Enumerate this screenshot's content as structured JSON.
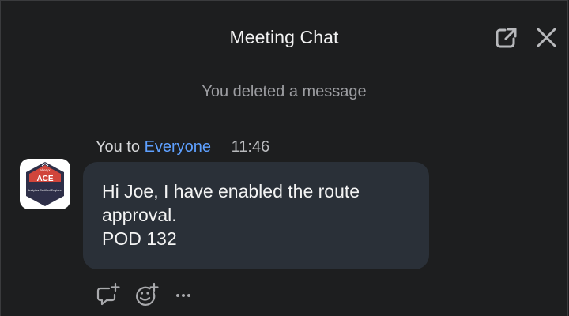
{
  "header": {
    "title": "Meeting Chat"
  },
  "icons": {
    "popout": "popout-icon",
    "close": "close-icon",
    "reply": "reply-thread-icon",
    "emoji": "add-reaction-icon",
    "more": "more-options-icon"
  },
  "system_message": "You deleted a message",
  "message": {
    "sender": "You to",
    "recipient": "Everyone",
    "time": "11:46",
    "avatar_badge": {
      "brand": "alteryx",
      "code": "ACE",
      "caption": "Analytics Certified Engineer"
    },
    "lines": [
      "Hi Joe, I have enabled the route",
      "approval.",
      "POD 132"
    ]
  },
  "colors": {
    "background": "#1d1e1f",
    "bubble": "#2a3038",
    "link": "#5ea0ff",
    "muted": "#9c9da1"
  }
}
